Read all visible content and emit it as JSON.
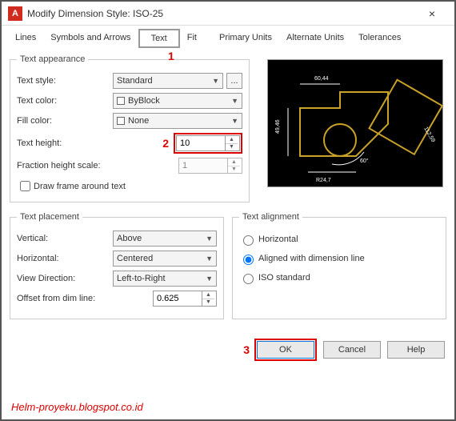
{
  "window": {
    "app_icon": "A",
    "title": "Modify Dimension Style: ISO-25",
    "close": "×"
  },
  "tabs": [
    "Lines",
    "Symbols and Arrows",
    "Text",
    "Fit",
    "Primary Units",
    "Alternate Units",
    "Tolerances"
  ],
  "active_tab": "Text",
  "appearance": {
    "legend": "Text appearance",
    "text_style_label": "Text style:",
    "text_style_value": "Standard",
    "browse": "...",
    "text_color_label": "Text color:",
    "text_color_value": "ByBlock",
    "fill_color_label": "Fill color:",
    "fill_color_value": "None",
    "text_height_label": "Text height:",
    "text_height_value": "10",
    "fraction_label": "Fraction height scale:",
    "fraction_value": "1",
    "draw_frame_label": "Draw frame around text"
  },
  "placement": {
    "legend": "Text placement",
    "vertical_label": "Vertical:",
    "vertical_value": "Above",
    "horizontal_label": "Horizontal:",
    "horizontal_value": "Centered",
    "viewdir_label": "View Direction:",
    "viewdir_value": "Left-to-Right",
    "offset_label": "Offset from dim line:",
    "offset_value": "0.625"
  },
  "alignment": {
    "legend": "Text alignment",
    "opt1": "Horizontal",
    "opt2": "Aligned with dimension line",
    "opt3": "ISO standard"
  },
  "buttons": {
    "ok": "OK",
    "cancel": "Cancel",
    "help": "Help"
  },
  "annotations": {
    "a1": "1",
    "a2": "2",
    "a3": "3"
  },
  "watermark": "Helm-proyeku.blogspot.co.id"
}
